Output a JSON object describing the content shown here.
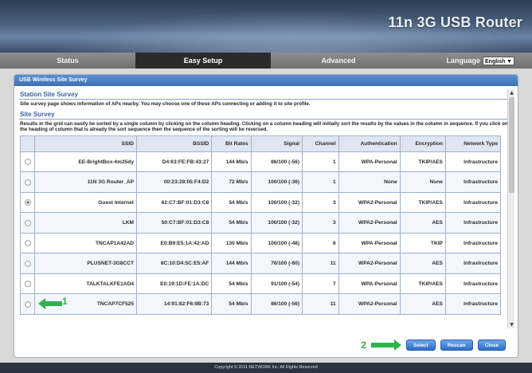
{
  "header": {
    "brand": "11n 3G USB Router"
  },
  "nav": {
    "tabs": [
      {
        "label": "Status"
      },
      {
        "label": "Easy Setup"
      },
      {
        "label": "Advanced"
      }
    ],
    "language_label": "Language",
    "language_value": "English"
  },
  "panel": {
    "title": "USB Wireless Site Survey",
    "station_heading": "Station Site Survey",
    "station_desc": "Site survey page shows information of APs nearby. You may choose one of these APs connecting or adding it to site profile.",
    "site_heading": "Site Survey",
    "site_desc": "Results in the grid can easily be sorted by a single column by clicking on the column heading. Clicking on a column heading will initially sort the results by the values in the column in sequence. If you click on the heading of column that is already the sort sequence then the sequence of the sorting will be reversed."
  },
  "table": {
    "headers": [
      "",
      "SSID",
      "BSSID",
      "Bit Rates",
      "Signal",
      "Channel",
      "Authentication",
      "Encryption",
      "Network Type"
    ],
    "rows": [
      {
        "ssid": "EE-BrightBox-4m25dy",
        "bssid": "D4:63:FE:FB:43:27",
        "rate": "144 Mb/s",
        "signal": "86/100 (-56)",
        "channel": "1",
        "auth": "WPA-Personal",
        "enc": "TKIP/AES",
        "type": "Infrastructure",
        "selected": false
      },
      {
        "ssid": "11N 3G Router_AP",
        "bssid": "00:23:28:05:F4:D2",
        "rate": "72 Mb/s",
        "signal": "100/100 (-36)",
        "channel": "1",
        "auth": "None",
        "enc": "None",
        "type": "Infrastructure",
        "selected": false
      },
      {
        "ssid": "Guest Internet",
        "bssid": "62:C7:BF:01:D3:C8",
        "rate": "54 Mb/s",
        "signal": "100/100 (-32)",
        "channel": "3",
        "auth": "WPA2-Personal",
        "enc": "TKIP/AES",
        "type": "Infrastructure",
        "selected": true
      },
      {
        "ssid": "LKM",
        "bssid": "50:C7:BF:01:D3:C8",
        "rate": "54 Mb/s",
        "signal": "100/100 (-32)",
        "channel": "3",
        "auth": "WPA2-Personal",
        "enc": "AES",
        "type": "Infrastructure",
        "selected": false
      },
      {
        "ssid": "TNCAP1A42AD",
        "bssid": "E0:B9:E5:1A:42:AD",
        "rate": "130 Mb/s",
        "signal": "100/100 (-48)",
        "channel": "6",
        "auth": "WPA-Personal",
        "enc": "TKIP",
        "type": "Infrastructure",
        "selected": false
      },
      {
        "ssid": "PLUSNET-3G8CCT",
        "bssid": "8C:10:D4:5C:E5:AF",
        "rate": "144 Mb/s",
        "signal": "76/100 (-60)",
        "channel": "11",
        "auth": "WPA2-Personal",
        "enc": "AES",
        "type": "Infrastructure",
        "selected": false
      },
      {
        "ssid": "TALKTALKFE1AD4",
        "bssid": "E0:19:1D:FE:1A:DC",
        "rate": "54 Mb/s",
        "signal": "91/100 (-54)",
        "channel": "7",
        "auth": "WPA-Personal",
        "enc": "TKIP/AES",
        "type": "Infrastructure",
        "selected": false
      },
      {
        "ssid": "TNCAP7CF525",
        "bssid": "14:91:82:F6:9B:73",
        "rate": "54 Mb/s",
        "signal": "86/100 (-56)",
        "channel": "11",
        "auth": "WPA2-Personal",
        "enc": "AES",
        "type": "Infrastructure",
        "selected": false
      }
    ]
  },
  "annotations": {
    "step1": "1",
    "step2": "2"
  },
  "buttons": {
    "select": "Select",
    "rescan": "Rescan",
    "close": "Close"
  },
  "footer": {
    "copyright": "Copyright © 2011 NETWORK Inc. All Rights Reserved"
  },
  "colors": {
    "accent": "#3f6fb4",
    "annotation": "#2db34a"
  }
}
